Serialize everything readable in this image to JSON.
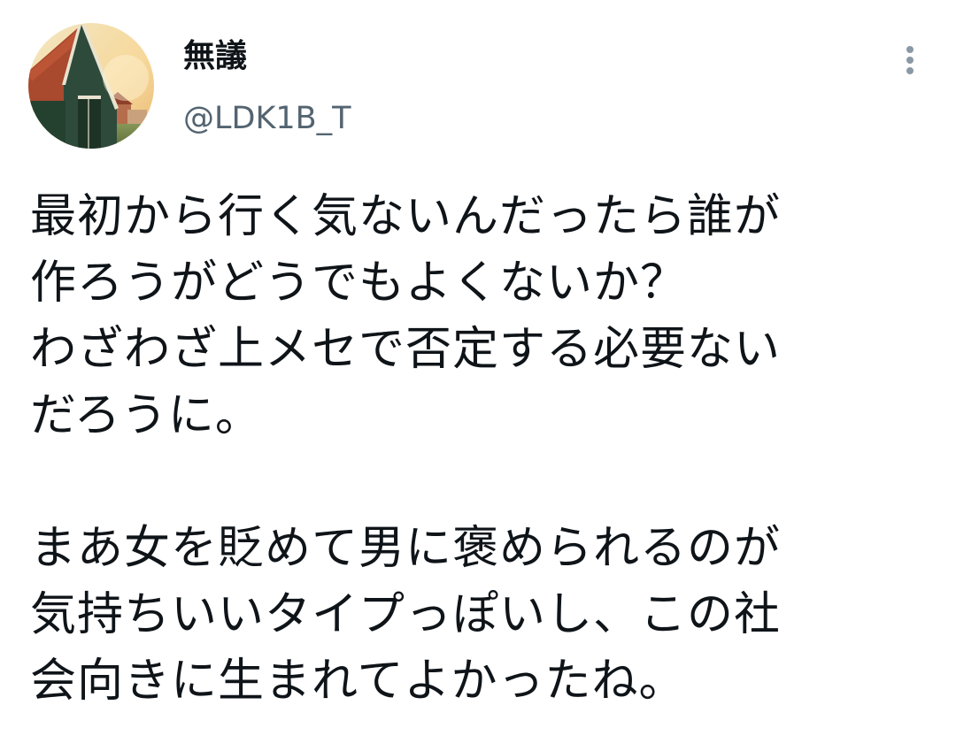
{
  "author": {
    "display_name": "無議",
    "handle": "@LDK1B_T",
    "avatar_icon": "barn-house-photo-icon"
  },
  "actions": {
    "more_icon": "more-vertical-icon"
  },
  "tweet": {
    "paragraph_1": [
      "最初から行く気ないんだったら誰が",
      "作ろうがどうでもよくないか？",
      "わざわざ上メセで否定する必要ない",
      "だろうに。"
    ],
    "paragraph_2": [
      "まあ女を貶めて男に褒められるのが",
      "気持ちいいタイプっぽいし、この社",
      "会向きに生まれてよかったね。"
    ]
  },
  "colors": {
    "text_primary": "#0f1419",
    "text_secondary": "#536471",
    "icon_gray": "#8b98a5"
  }
}
